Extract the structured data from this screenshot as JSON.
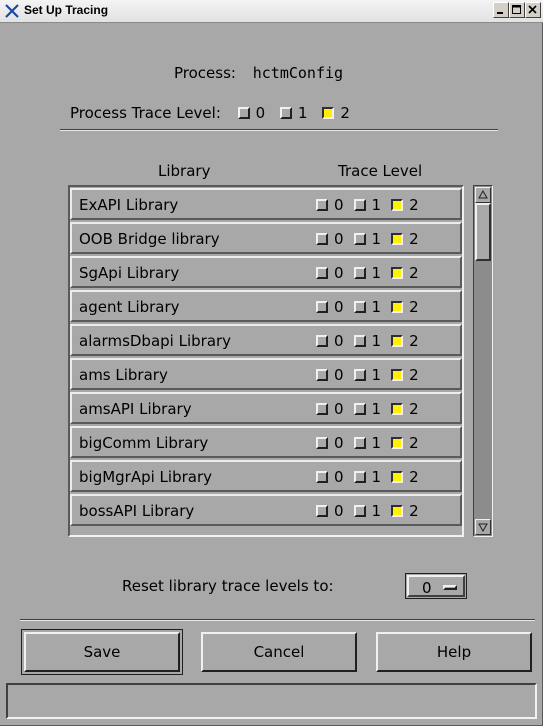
{
  "window": {
    "title": "Set Up Tracing",
    "app_icon": "x-icon"
  },
  "process": {
    "label": "Process:",
    "name": "hctmConfig",
    "trace_label": "Process Trace Level:",
    "levels": [
      "0",
      "1",
      "2"
    ],
    "selected_level": "2"
  },
  "library_header": {
    "library": "Library",
    "trace_level": "Trace Level"
  },
  "libraries": [
    {
      "name": "ExAPI Library",
      "selected_level": "2"
    },
    {
      "name": "OOB Bridge library",
      "selected_level": "2"
    },
    {
      "name": "SgApi Library",
      "selected_level": "2"
    },
    {
      "name": "agent Library",
      "selected_level": "2"
    },
    {
      "name": "alarmsDbapi Library",
      "selected_level": "2"
    },
    {
      "name": "ams Library",
      "selected_level": "2"
    },
    {
      "name": "amsAPI Library",
      "selected_level": "2"
    },
    {
      "name": "bigComm Library",
      "selected_level": "2"
    },
    {
      "name": "bigMgrApi Library",
      "selected_level": "2"
    },
    {
      "name": "bossAPI Library",
      "selected_level": "2"
    }
  ],
  "reset": {
    "label": "Reset library trace levels to:",
    "value": "0"
  },
  "buttons": {
    "save": "Save",
    "cancel": "Cancel",
    "help": "Help"
  },
  "status_text": "",
  "colors": {
    "background": "#a8a8a8",
    "checked": "#ffef00"
  }
}
